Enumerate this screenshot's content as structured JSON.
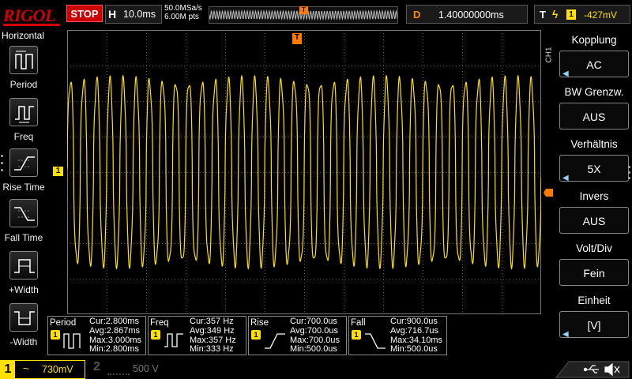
{
  "topbar": {
    "logo": "RIGOL",
    "run_state": "STOP",
    "horizontal_label": "H",
    "timebase": "10.0ms",
    "sample_rate": "50.0MSa/s",
    "memory_depth": "6.00M pts",
    "memory_trigger_marker": "T",
    "delay_label": "D",
    "delay_value": "1.40000000ms",
    "trigger_label": "T",
    "trigger_channel": "1",
    "trigger_level": "-427mV"
  },
  "left_menu": {
    "title": "Horizontal",
    "items": [
      {
        "label": "Period",
        "icon": "period-icon"
      },
      {
        "label": "Freq",
        "icon": "freq-icon"
      },
      {
        "label": "Rise Time",
        "icon": "rise-time-icon"
      },
      {
        "label": "Fall Time",
        "icon": "fall-time-icon"
      },
      {
        "label": "+Width",
        "icon": "pos-width-icon"
      },
      {
        "label": "-Width",
        "icon": "neg-width-icon"
      }
    ]
  },
  "markers": {
    "trigger_position": "T",
    "ch1_ground": "1"
  },
  "right_menu": {
    "channel_label": "CH1",
    "items": [
      {
        "title": "Kopplung",
        "value": "AC",
        "has_arrow": true
      },
      {
        "title": "BW Grenzw.",
        "value": "AUS",
        "has_arrow": false
      },
      {
        "title": "Verhältnis",
        "value": "5X",
        "has_arrow": true
      },
      {
        "title": "Invers",
        "value": "AUS",
        "has_arrow": false
      },
      {
        "title": "Volt/Div",
        "value": "Fein",
        "has_arrow": false
      },
      {
        "title": "Einheit",
        "value": "[V]",
        "has_arrow": true
      }
    ]
  },
  "measurements": [
    {
      "name": "Period",
      "channel": "1",
      "cur": "Cur:2.800ms",
      "avg": "Avg:2.867ms",
      "max": "Max:3.000ms",
      "min": "Min:2.800ms"
    },
    {
      "name": "Freq",
      "channel": "1",
      "cur": "Cur:357 Hz",
      "avg": "Avg:349 Hz",
      "max": "Max:357 Hz",
      "min": "Min:333 Hz"
    },
    {
      "name": "Rise",
      "channel": "1",
      "cur": "Cur:700.0us",
      "avg": "Avg:700.0us",
      "max": "Max:700.0us",
      "min": "Min:500.0us"
    },
    {
      "name": "Fall",
      "channel": "1",
      "cur": "Cur:900.0us",
      "avg": "Avg:716.7us",
      "max": "Max:34.10ms",
      "min": "Min:500.0us"
    }
  ],
  "bottombar": {
    "ch1_number": "1",
    "ch1_coupling": "~",
    "ch1_scale": "730mV",
    "ch2_number": "2",
    "ch2_scale": "500 V"
  },
  "waveform": {
    "cycles_on_screen": 36,
    "amplitude_fraction": 0.64,
    "color": "#ffe000"
  },
  "colors": {
    "ch1": "#ffe000",
    "trigger": "#ff7a00",
    "stop": "#cc0000",
    "brand": "#d40000"
  }
}
